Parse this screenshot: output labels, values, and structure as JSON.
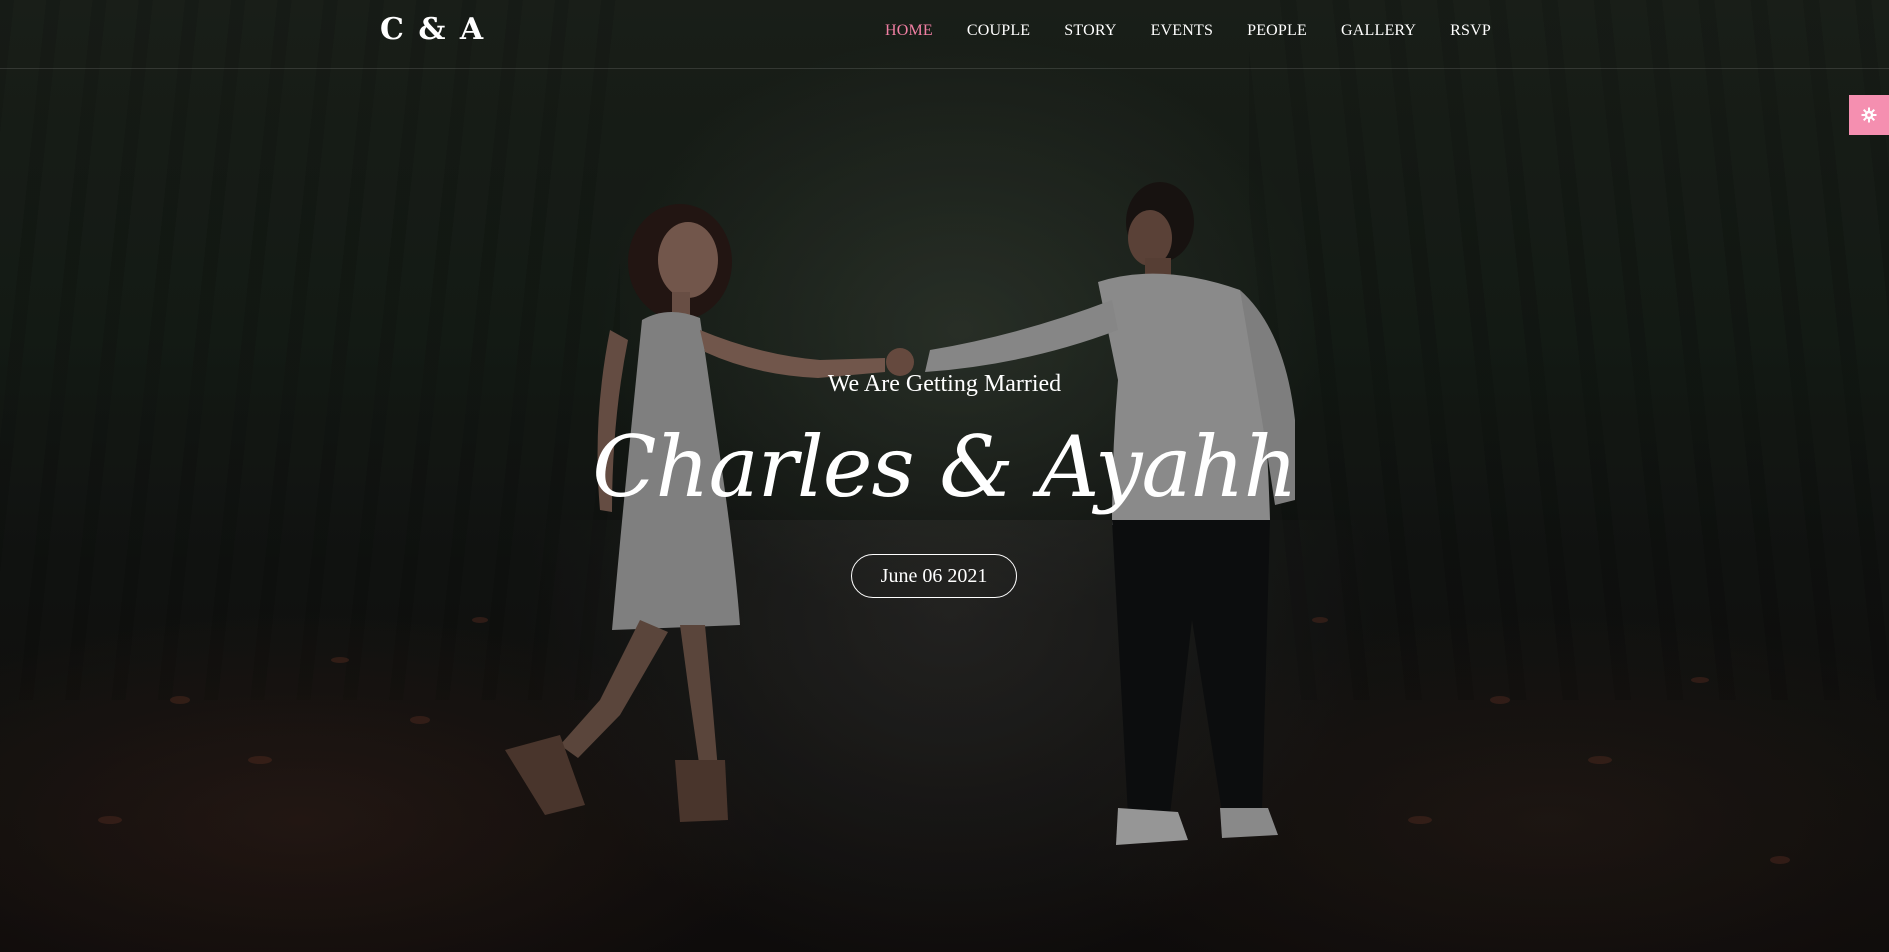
{
  "site": {
    "logo": "C & A"
  },
  "nav": {
    "items": [
      {
        "label": "HOME",
        "active": true
      },
      {
        "label": "COUPLE",
        "active": false
      },
      {
        "label": "STORY",
        "active": false
      },
      {
        "label": "EVENTS",
        "active": false
      },
      {
        "label": "PEOPLE",
        "active": false
      },
      {
        "label": "GALLERY",
        "active": false
      },
      {
        "label": "RSVP",
        "active": false
      }
    ],
    "active_color": "#f07fa3"
  },
  "hero": {
    "subtitle": "We Are Getting Married",
    "names": "Charles & Ayahh",
    "date_label": "June 06 2021",
    "background": "couple-photo-forest-road"
  },
  "settings": {
    "icon": "gear-icon",
    "color": "#f58fb0"
  }
}
